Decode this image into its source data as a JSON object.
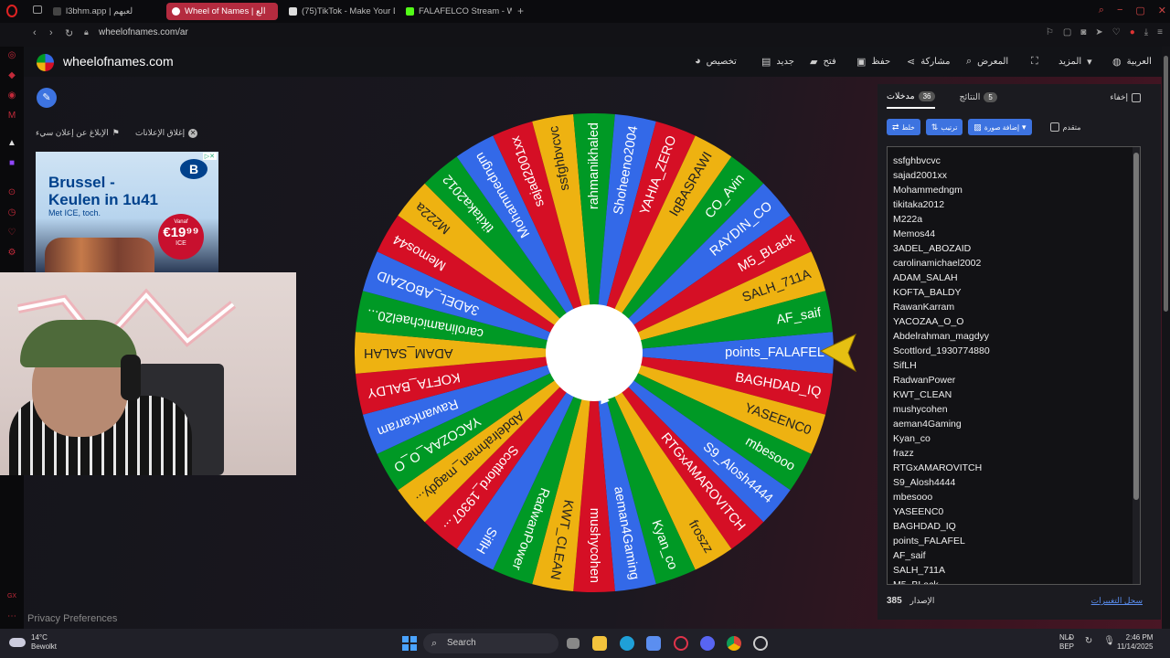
{
  "browser": {
    "tabs": [
      {
        "label": "l3bhm.app | لعبهم",
        "active": false,
        "icon_color": "#444444"
      },
      {
        "label": "Wheel of Names | الع",
        "active": true,
        "icon_color": "#ffffff"
      },
      {
        "label": "(75)TikTok - Make Your D",
        "active": false,
        "icon_color": "#dddddd"
      },
      {
        "label": "FALAFELCO Stream - Wat",
        "active": false,
        "icon_color": "#53fc18"
      }
    ],
    "url": "wheelofnames.com/ar"
  },
  "header": {
    "site_name": "wheelofnames.com",
    "menu": {
      "customize": "تخصيص",
      "new": "جديد",
      "open": "فتح",
      "save": "حفظ",
      "share": "مشاركة",
      "gallery": "المعرض",
      "more": "المزيد",
      "language": "العربية"
    }
  },
  "ad_controls": {
    "report": "الإبلاغ عن إعلان سيء",
    "close_ads": "إغلاق الإعلانات"
  },
  "ad": {
    "headline": "Brussel - Keulen in 1u41",
    "sub": "Met ICE, toch.",
    "logo": "B",
    "price_prefix": "Vanaf",
    "price": "€19⁹⁹",
    "price_suffix": "ICE"
  },
  "privacy": "Privacy Preferences",
  "wheel": {
    "colors": [
      "#3369e8",
      "#d50f25",
      "#eeb211",
      "#009925"
    ],
    "segments": [
      "points_FALAFEL",
      "BAGHDAD_IQ",
      "YASEENC0",
      "mbesooo",
      "S9_Alosh4444",
      "RTGxAMAROVITCH",
      "froszz",
      "Kyan_co",
      "aeman4Gaming",
      "mushycohen",
      "KWT_CLEAN",
      "RadwanPower",
      "SiflH",
      "Scottlord_19307...",
      "Abdelrahman_magdy...",
      "YACOZAA_O_O",
      "RawanKarram",
      "KOFTA_BALDY",
      "ADAM_SALAH",
      "carolinamichael20...",
      "3ADEL_ABOZAID",
      "Memos44",
      "M222a",
      "tikitaka2012",
      "Mohammedngm",
      "sajad2001xx",
      "ssfghbvcvc",
      "rahmanikhaled",
      "Shoheeno2004",
      "YAHIA_ZERO",
      "IqBASRAWI",
      "CO_Avin",
      "RAYDIN_CO",
      "M5_BLack",
      "SALH_711A",
      "AF_saif"
    ]
  },
  "panel": {
    "tab_entries": "مدخلات",
    "entries_count": "36",
    "tab_results": "النتائج",
    "results_count": "5",
    "hide": "إخفاء",
    "shuffle": "خلط",
    "sort": "ترتيب",
    "add_image": "إضافة صورة",
    "advanced": "متقدم",
    "entries": [
      "ssfghbvcvc",
      "sajad2001xx",
      "Mohammedngm",
      "tikitaka2012",
      "M222a",
      "Memos44",
      "3ADEL_ABOZAID",
      "carolinamichael2002",
      "ADAM_SALAH",
      "KOFTA_BALDY",
      "RawanKarram",
      "YACOZAA_O_O",
      "Abdelrahman_magdyy",
      "Scottlord_1930774880",
      "SifLH",
      "RadwanPower",
      "KWT_CLEAN",
      "mushycohen",
      "aeman4Gaming",
      "Kyan_co",
      "frazz",
      "RTGxAMAROVITCH",
      "S9_Alosh4444",
      "mbesooo",
      "YASEENC0",
      "BAGHDAD_IQ",
      "points_FALAFEL",
      "AF_saif",
      "SALH_711A",
      "M5_BLack"
    ],
    "version_label": "الإصدار",
    "version": "385",
    "changelog": "سجل التغييرات"
  },
  "taskbar": {
    "temp": "14°C",
    "weather": "Bewolkt",
    "search": "Search",
    "lang1": "NLD",
    "lang2": "BEP",
    "time": "2:46 PM",
    "date": "11/14/2025"
  }
}
